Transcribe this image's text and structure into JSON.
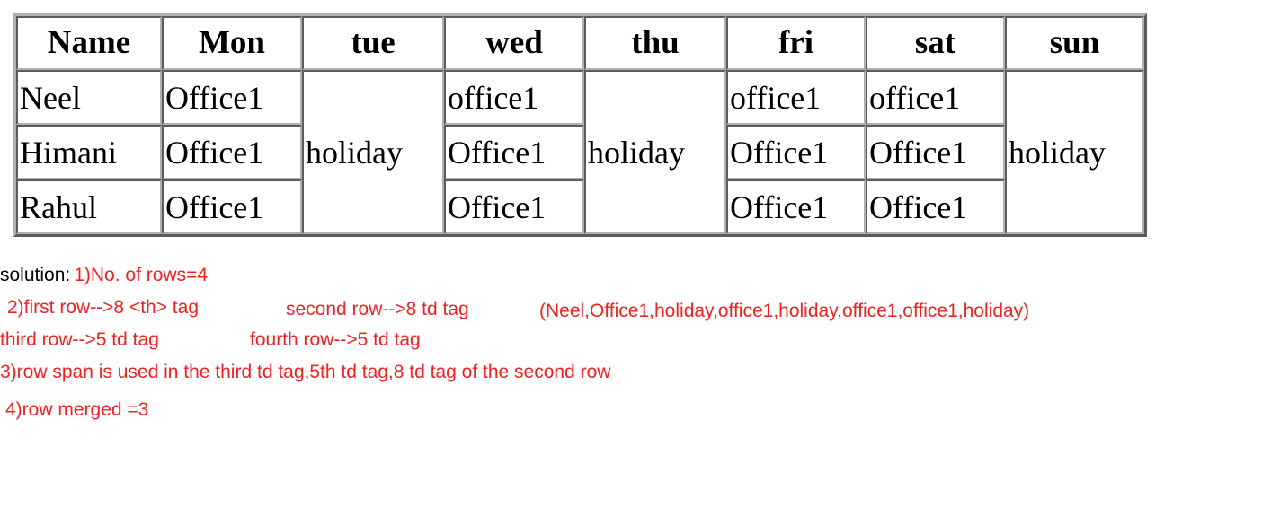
{
  "table": {
    "headers": [
      "Name",
      "Mon",
      "tue",
      "wed",
      "thu",
      "fri",
      "sat",
      "sun"
    ],
    "rows": [
      {
        "name": "Neel",
        "mon": "Office1",
        "tue": "holiday",
        "wed": "office1",
        "thu": "holiday",
        "fri": "office1",
        "sat": "office1",
        "sun": "holiday"
      },
      {
        "name": "Himani",
        "mon": "Office1",
        "wed": "Office1",
        "fri": "Office1",
        "sat": "Office1"
      },
      {
        "name": "Rahul",
        "mon": "Office1",
        "wed": "Office1",
        "fri": "Office1",
        "sat": "Office1"
      }
    ]
  },
  "annotations": {
    "solution_label": "solution:",
    "line1": "1)No. of rows=4",
    "line2_a": "2)first row-->8 <th> tag",
    "line2_b": "second row-->8 td tag",
    "line2_c": "(Neel,Office1,holiday,office1,holiday,office1,office1,holiday)",
    "line3_a": "third row-->5 td tag",
    "line3_b": "fourth row-->5 td tag",
    "line4": "3)row span is used in the third td tag,5th td tag,8 td tag of the second row",
    "line5": "4)row merged =3"
  },
  "colors": {
    "annotation_red": "#ee2222",
    "label_black": "#000000",
    "table_border": "#b0b0b0",
    "cell_background": "#ffffff"
  }
}
